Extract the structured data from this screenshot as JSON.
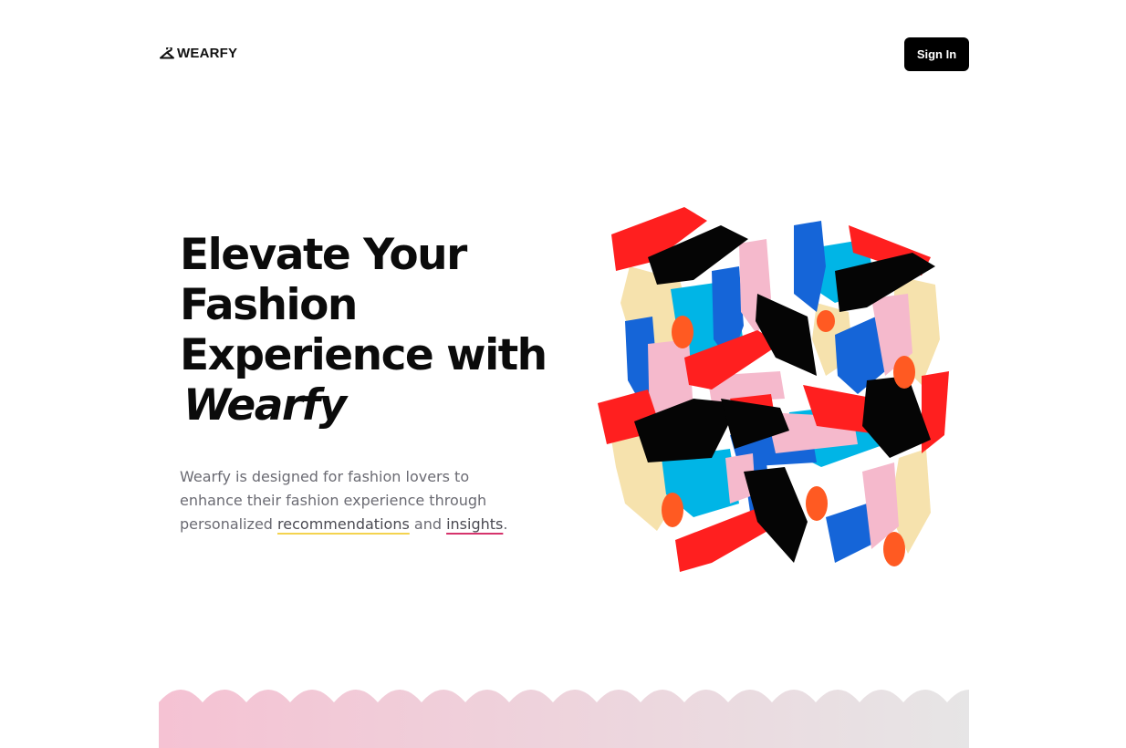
{
  "nav": {
    "logo_text": "WEARFY",
    "signin_label": "Sign In"
  },
  "hero": {
    "title_lines": [
      "Elevate Your",
      "Fashion",
      "Experience with"
    ],
    "title_brand": "Wearfy",
    "description_before": "Wearfy is designed for fashion lovers to enhance their fashion experience through personalized ",
    "description_link1": "recommendations",
    "description_between": " and ",
    "description_link2": "insights",
    "description_after": "."
  },
  "colors": {
    "signin_bg": "#000000",
    "accent_yellow": "#f4d34f",
    "accent_pink": "#d6336c",
    "band_pink": "#f5c2d3",
    "band_gray": "#e6e6e6",
    "art_red": "#ff1f1f",
    "art_black": "#050505",
    "art_cyan": "#00b5e6",
    "art_blue": "#1565d8",
    "art_pink": "#f5b9cc",
    "art_cream": "#f6e2ad",
    "art_orange": "#ff5a22"
  },
  "icons": {
    "logo": "hanger-icon"
  }
}
